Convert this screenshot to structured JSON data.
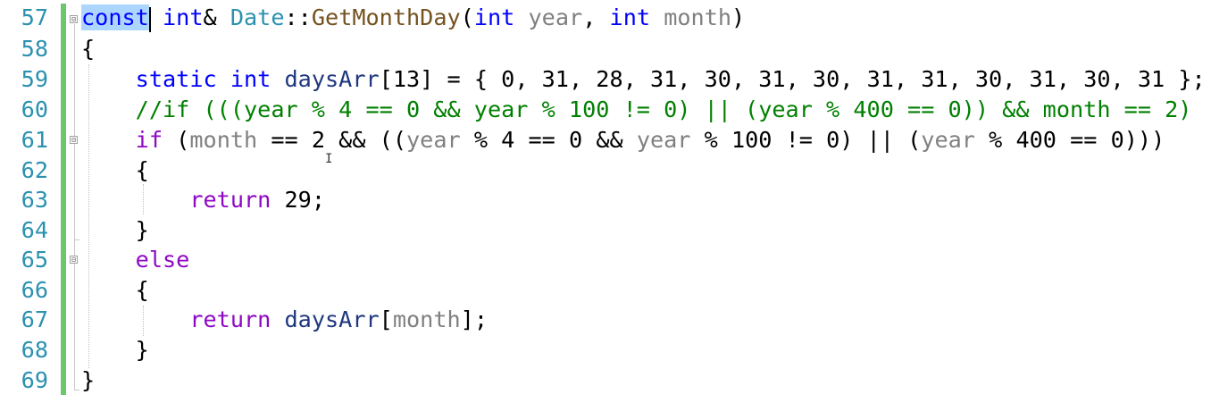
{
  "editor": {
    "lines": [
      {
        "num": "57",
        "tokens": [
          {
            "t": "const",
            "c": "kw sel"
          },
          {
            "t": " ",
            "c": ""
          },
          {
            "t": "int",
            "c": "kw"
          },
          {
            "t": "& ",
            "c": ""
          },
          {
            "t": "Date",
            "c": "type"
          },
          {
            "t": "::",
            "c": ""
          },
          {
            "t": "GetMonthDay",
            "c": "fn"
          },
          {
            "t": "(",
            "c": ""
          },
          {
            "t": "int",
            "c": "kw"
          },
          {
            "t": " ",
            "c": ""
          },
          {
            "t": "year",
            "c": "param"
          },
          {
            "t": ", ",
            "c": ""
          },
          {
            "t": "int",
            "c": "kw"
          },
          {
            "t": " ",
            "c": ""
          },
          {
            "t": "month",
            "c": "param"
          },
          {
            "t": ")",
            "c": ""
          }
        ]
      },
      {
        "num": "58",
        "tokens": [
          {
            "t": "{",
            "c": ""
          }
        ]
      },
      {
        "num": "59",
        "tokens": [
          {
            "t": "    ",
            "c": ""
          },
          {
            "t": "static",
            "c": "kw"
          },
          {
            "t": " ",
            "c": ""
          },
          {
            "t": "int",
            "c": "kw"
          },
          {
            "t": " ",
            "c": ""
          },
          {
            "t": "daysArr",
            "c": "var"
          },
          {
            "t": "[13] = { 0, 31, 28, 31, 30, 31, 30, 31, 31, 30, 31, 30, 31 };",
            "c": ""
          }
        ]
      },
      {
        "num": "60",
        "tokens": [
          {
            "t": "    ",
            "c": ""
          },
          {
            "t": "//if (((year % 4 == 0 && year % 100 != 0) || (year % 400 == 0)) && month == 2)",
            "c": "cm"
          }
        ]
      },
      {
        "num": "61",
        "tokens": [
          {
            "t": "    ",
            "c": ""
          },
          {
            "t": "if",
            "c": "ctl"
          },
          {
            "t": " (",
            "c": ""
          },
          {
            "t": "month",
            "c": "param"
          },
          {
            "t": " == 2 && ((",
            "c": ""
          },
          {
            "t": "year",
            "c": "param"
          },
          {
            "t": " % 4 == 0 && ",
            "c": ""
          },
          {
            "t": "year",
            "c": "param"
          },
          {
            "t": " % 100 != 0) || (",
            "c": ""
          },
          {
            "t": "year",
            "c": "param"
          },
          {
            "t": " % 400 == 0)))",
            "c": ""
          }
        ]
      },
      {
        "num": "62",
        "tokens": [
          {
            "t": "    {",
            "c": ""
          }
        ]
      },
      {
        "num": "63",
        "tokens": [
          {
            "t": "        ",
            "c": ""
          },
          {
            "t": "return",
            "c": "ctl"
          },
          {
            "t": " 29;",
            "c": ""
          }
        ]
      },
      {
        "num": "64",
        "tokens": [
          {
            "t": "    }",
            "c": ""
          }
        ]
      },
      {
        "num": "65",
        "tokens": [
          {
            "t": "    ",
            "c": ""
          },
          {
            "t": "else",
            "c": "ctl"
          }
        ]
      },
      {
        "num": "66",
        "tokens": [
          {
            "t": "    {",
            "c": ""
          }
        ]
      },
      {
        "num": "67",
        "tokens": [
          {
            "t": "        ",
            "c": ""
          },
          {
            "t": "return",
            "c": "ctl"
          },
          {
            "t": " ",
            "c": ""
          },
          {
            "t": "daysArr",
            "c": "var"
          },
          {
            "t": "[",
            "c": ""
          },
          {
            "t": "month",
            "c": "param"
          },
          {
            "t": "];",
            "c": ""
          }
        ]
      },
      {
        "num": "68",
        "tokens": [
          {
            "t": "    }",
            "c": ""
          }
        ]
      },
      {
        "num": "69",
        "tokens": [
          {
            "t": "}",
            "c": ""
          }
        ]
      }
    ],
    "fold_glyph": "⊟",
    "cursor_icon": "I"
  }
}
